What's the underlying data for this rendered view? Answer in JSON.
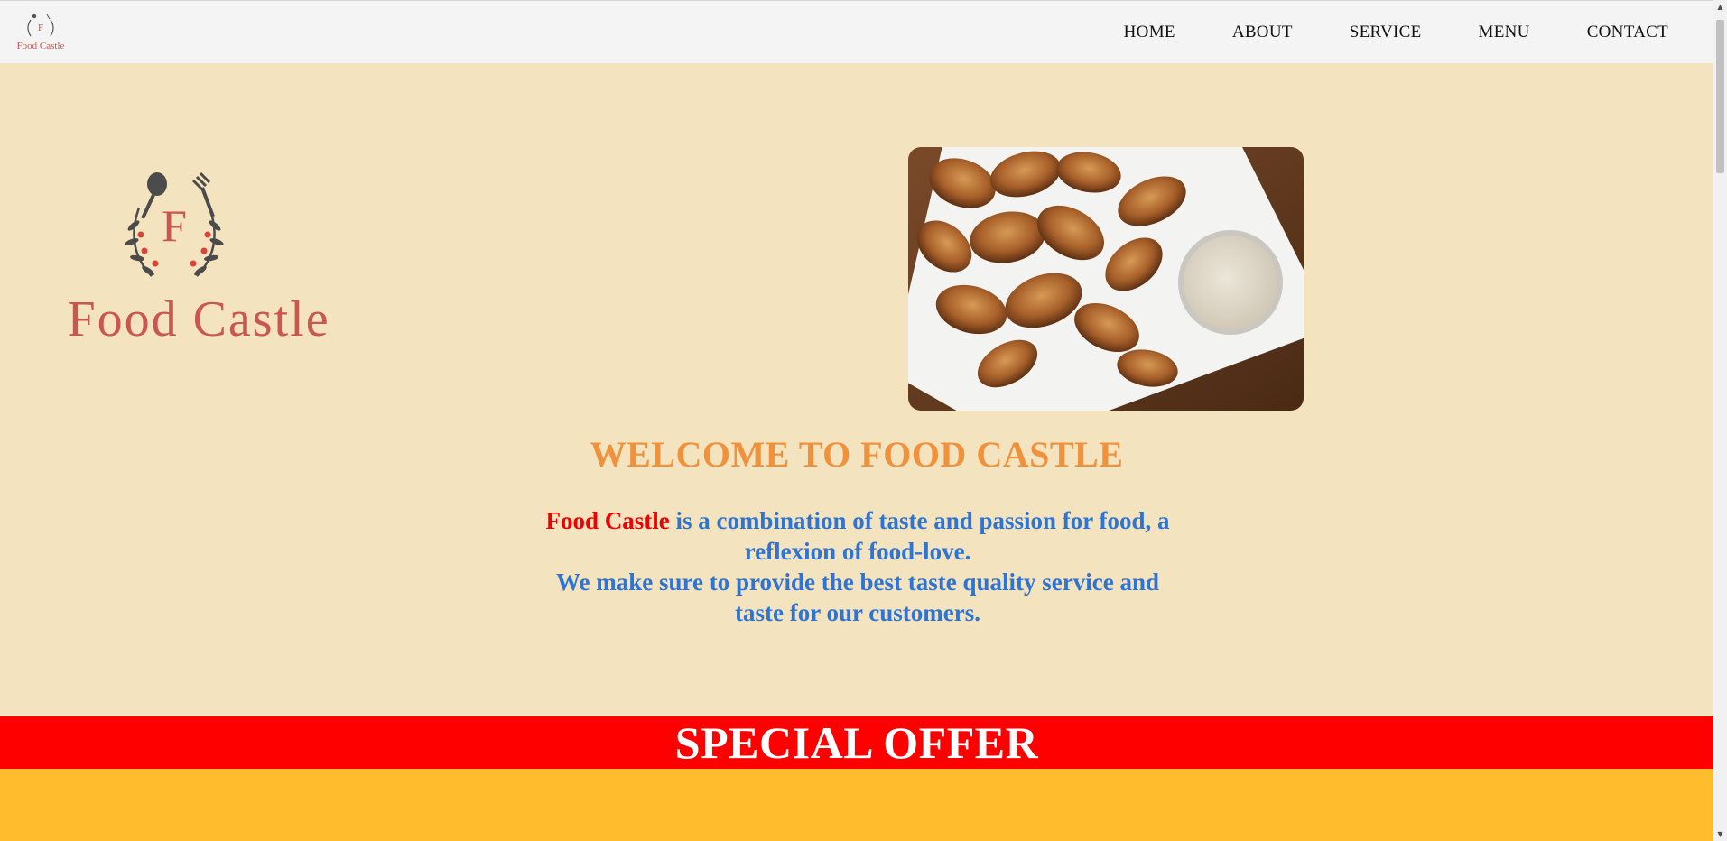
{
  "brand": {
    "name": "Food Castle",
    "initial": "F",
    "logo_color": "#c9564f",
    "logo_icon": "spoon-fork-wreath-icon"
  },
  "nav": {
    "items": [
      {
        "label": "HOME"
      },
      {
        "label": "ABOUT"
      },
      {
        "label": "SERVICE"
      },
      {
        "label": "MENU"
      },
      {
        "label": "CONTACT"
      }
    ]
  },
  "hero": {
    "photo": "chicken-wings-with-dip-photo",
    "welcome": "WELCOME TO FOOD CASTLE",
    "intro_brand": "Food Castle",
    "intro_line1": " is a combination of taste and passion for food, a reflexion of food-love.",
    "intro_line2": "We make sure to provide the best taste quality service and taste for our customers."
  },
  "offer": {
    "title": "SPECIAL OFFER"
  },
  "colors": {
    "page_bg": "#f4e3bf",
    "nav_bg": "#f4f4f4",
    "welcome": "#f0923c",
    "intro_text": "#2d74d4",
    "brand_red": "#f00000",
    "offer_bar": "#ff0000",
    "offer_area": "#ffbc2c"
  }
}
